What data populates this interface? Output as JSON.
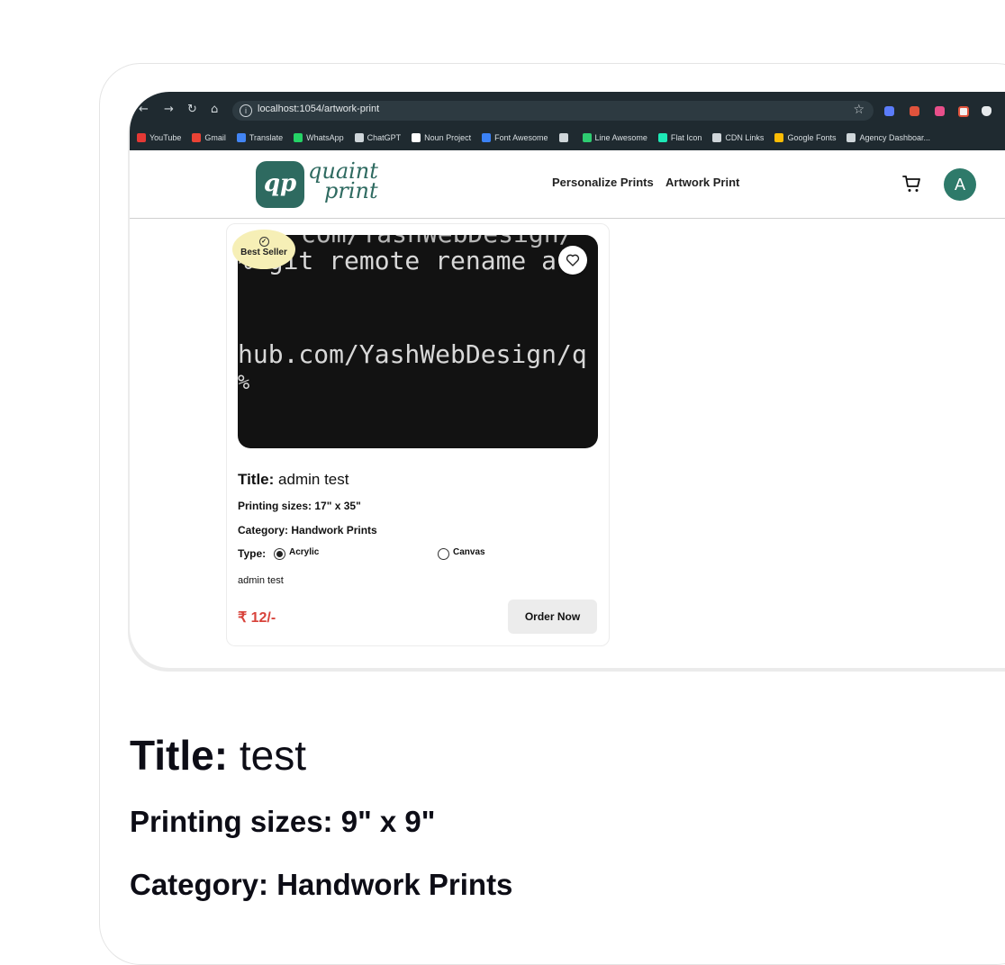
{
  "browser": {
    "nav_icons": [
      "back-icon",
      "forward-icon",
      "reload-icon",
      "home-icon"
    ],
    "url": "localhost:1054/artwork-print",
    "bookmarks": [
      {
        "label": "YouTube",
        "color": "#e53935"
      },
      {
        "label": "Gmail",
        "color": "#ea4335"
      },
      {
        "label": "Translate",
        "color": "#4285f4"
      },
      {
        "label": "WhatsApp",
        "color": "#25d366"
      },
      {
        "label": "ChatGPT",
        "color": "#cfd6da"
      },
      {
        "label": "Noun Project",
        "color": "#ffffff"
      },
      {
        "label": "Font Awesome",
        "color": "#3b82f6"
      },
      {
        "label": "",
        "color": "#cfd6da"
      },
      {
        "label": "Line Awesome",
        "color": "#2ecc71"
      },
      {
        "label": "Flat Icon",
        "color": "#1de9b6"
      },
      {
        "label": "CDN Links",
        "color": "#cfd6da"
      },
      {
        "label": "Google Fonts",
        "color": "#fbbc05"
      },
      {
        "label": "Agency Dashboar...",
        "color": "#cfd6da"
      }
    ]
  },
  "header": {
    "logo_mark": "qp",
    "logo_line1": "quaint",
    "logo_line2": "print",
    "nav": [
      "Personalize Prints",
      "Artwork Print"
    ],
    "avatar_initial": "A",
    "brand_color": "#2e6a60"
  },
  "product": {
    "image_text": [
      "com/YashWebDesign/",
      "% git remote rename  a",
      "hub.com/YashWebDesign/q",
      "%"
    ],
    "badge": "Best Seller",
    "title_label": "Title:",
    "title_value": "admin test",
    "sizes_label": "Printing sizes:",
    "sizes_value": "17\" x 35\"",
    "category_label": "Category:",
    "category_value": "Handwork Prints",
    "type_label": "Type:",
    "type_options": [
      {
        "label": "Acrylic",
        "selected": true
      },
      {
        "label": "Canvas",
        "selected": false
      }
    ],
    "description": "admin test",
    "price": "₹ 12/-",
    "price_color": "#d8433b",
    "order_button": "Order Now"
  },
  "details": {
    "title_label": "Title:",
    "title_value": "test",
    "sizes_label": "Printing sizes:",
    "sizes_value": "9\" x 9\"",
    "category_label": "Category:",
    "category_value": "Handwork Prints"
  }
}
